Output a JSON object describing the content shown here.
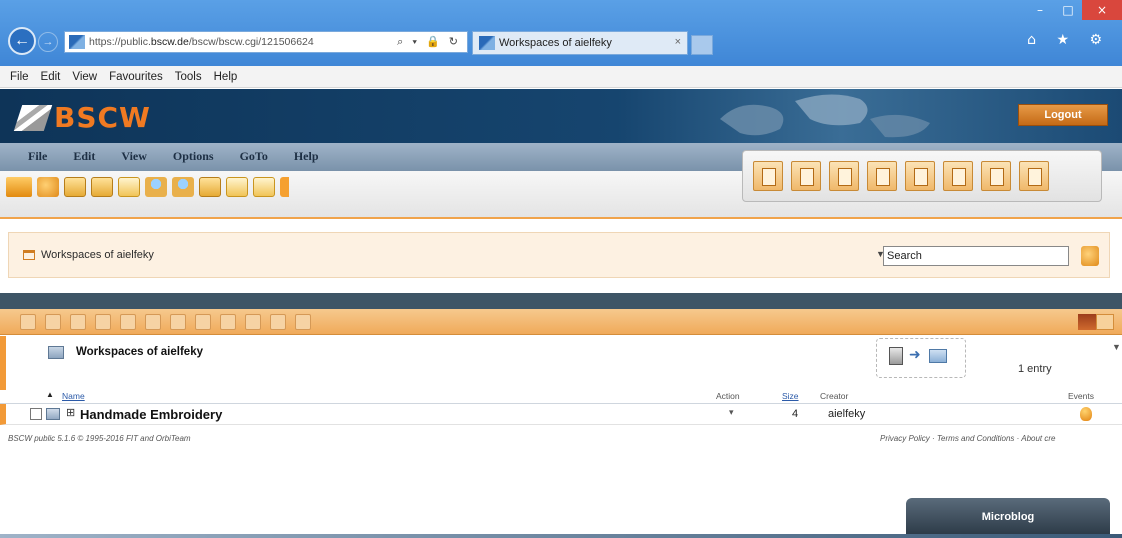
{
  "browser": {
    "url_host_prefix": "https://public.",
    "url_host": "bscw.de",
    "url_path": "/bscw/bscw.cgi/121506624",
    "address_icons": "⌕ ▾ 🔒 ↻",
    "tab_title": "Workspaces of aielfeky",
    "tab_close": "×",
    "menu": [
      "File",
      "Edit",
      "View",
      "Favourites",
      "Tools",
      "Help"
    ],
    "window_buttons": {
      "minimize": "–",
      "maximize": "□",
      "close": "×"
    },
    "toolbar_icons": "⌂ ★ ⚙"
  },
  "bscw": {
    "logo_text": "BSCW",
    "logout_label": "Logout",
    "menu": [
      "File",
      "Edit",
      "View",
      "Options",
      "GoTo",
      "Help"
    ],
    "breadcrumb": "Workspaces of aielfeky",
    "search": {
      "label": "Search",
      "value": "Search"
    },
    "folder_title": "Workspaces of aielfeky",
    "entry_count": "1 entry",
    "table": {
      "columns": {
        "name": "Name",
        "action": "Action",
        "size": "Size",
        "creator": "Creator",
        "events": "Events"
      },
      "rows": [
        {
          "name": "Handmade Embroidery",
          "action": "▾",
          "size": "4",
          "creator": "aielfeky"
        }
      ]
    },
    "footer_left": "BSCW public 5.1.6 © 1995-2016 FIT and OrbiTeam",
    "footer_right": "Privacy Policy · Terms and Conditions · About cre",
    "microblog_label": "Microblog"
  },
  "colors": {
    "accent": "#f29a38",
    "header_dark": "#0e3458",
    "logo": "#f07a22"
  }
}
